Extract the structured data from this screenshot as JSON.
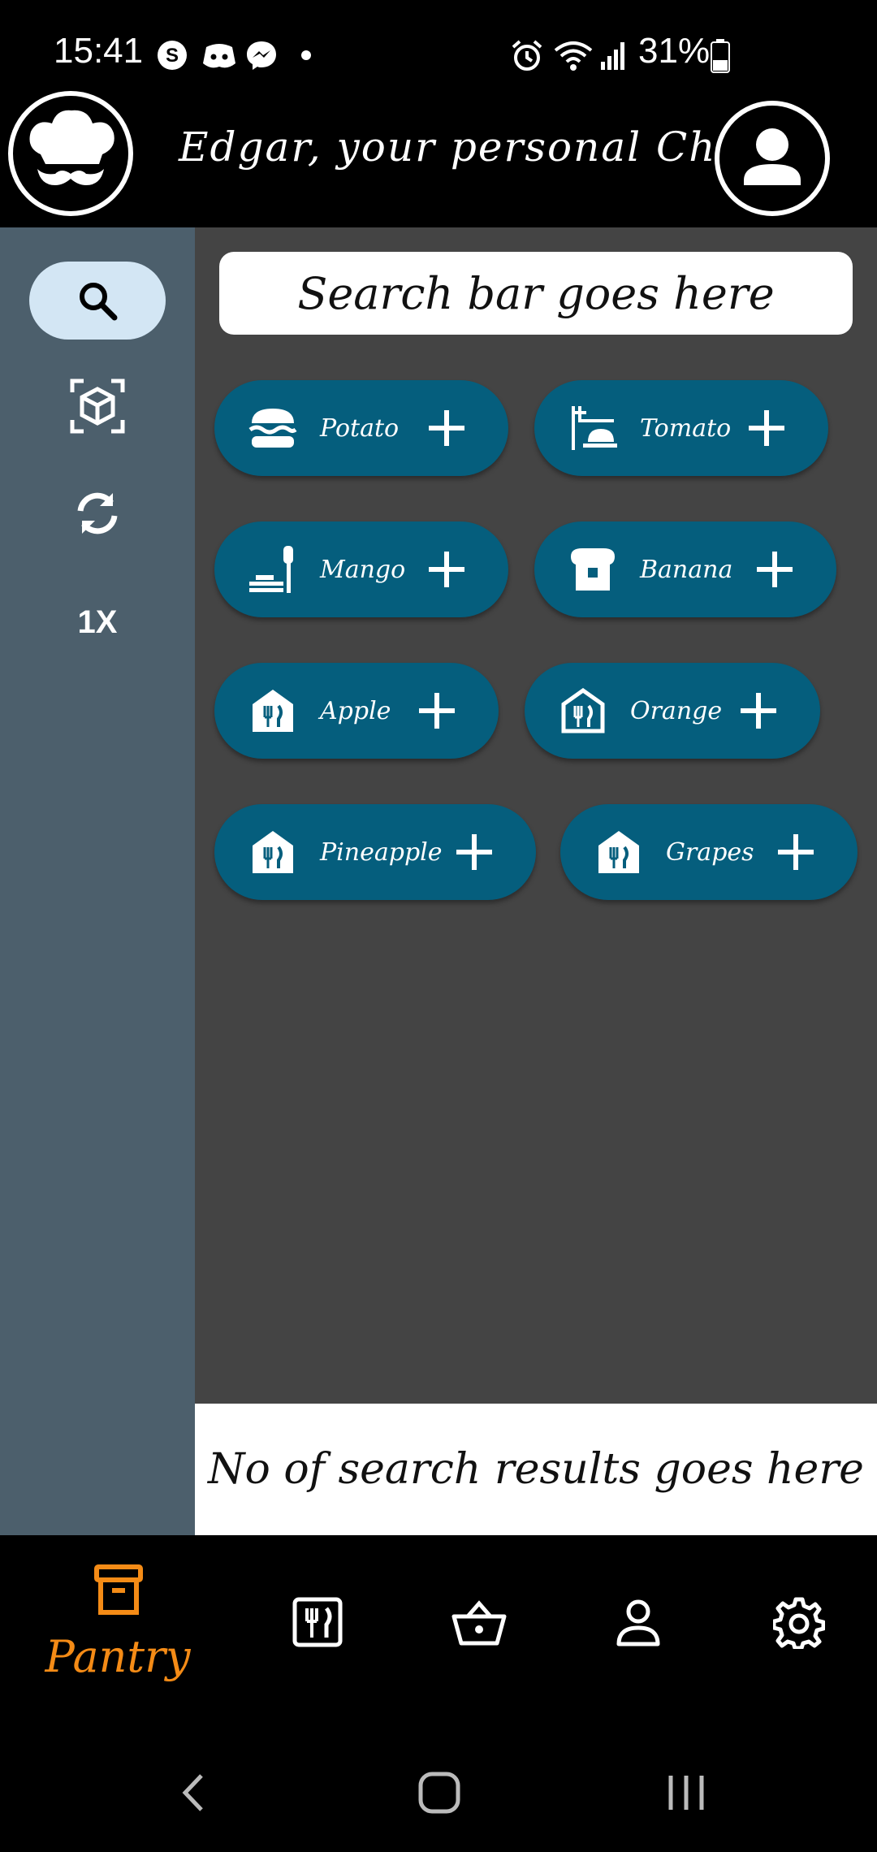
{
  "status_bar": {
    "time": "15:41",
    "battery_percent": "31%",
    "notification_icons": [
      "skype-icon",
      "discord-icon",
      "messenger-icon",
      "dot-icon"
    ],
    "system_icons": [
      "alarm-icon",
      "wifi-icon",
      "signal-icon",
      "battery-icon"
    ]
  },
  "header": {
    "title": "Edgar, your personal Chef",
    "logo_icon": "chef-hat-mustache-icon",
    "profile_icon": "account-circle-icon"
  },
  "sidebar": {
    "items": [
      {
        "icon": "search-icon",
        "active": true
      },
      {
        "icon": "scan-box-icon",
        "active": false
      },
      {
        "icon": "refresh-icon",
        "active": false
      },
      {
        "label": "1X",
        "active": false
      }
    ]
  },
  "search": {
    "placeholder": "Search bar goes here"
  },
  "ingredients": [
    {
      "label": "Potato",
      "icon": "burger-icon"
    },
    {
      "label": "Tomato",
      "icon": "dining-icon"
    },
    {
      "label": "Mango",
      "icon": "dinner-table-icon"
    },
    {
      "label": "Banana",
      "icon": "bread-slice-icon"
    },
    {
      "label": "Apple",
      "icon": "restaurant-house-icon"
    },
    {
      "label": "Orange",
      "icon": "restaurant-house-outline-icon"
    },
    {
      "label": "Pineapple",
      "icon": "restaurant-house-icon"
    },
    {
      "label": "Grapes",
      "icon": "restaurant-house-icon"
    }
  ],
  "results": {
    "text": "No of search results goes here"
  },
  "bottom_nav": {
    "items": [
      {
        "label": "Pantry",
        "icon": "archive-box-icon",
        "active": true
      },
      {
        "icon": "menu-book-icon"
      },
      {
        "icon": "basket-icon"
      },
      {
        "icon": "person-icon"
      },
      {
        "icon": "settings-icon"
      }
    ]
  },
  "colors": {
    "accent": "#f48b16",
    "chip": "#055e7d",
    "sidebar": "#4c5f6c",
    "main_bg": "#444444",
    "active_pill": "#d3e6f4"
  }
}
